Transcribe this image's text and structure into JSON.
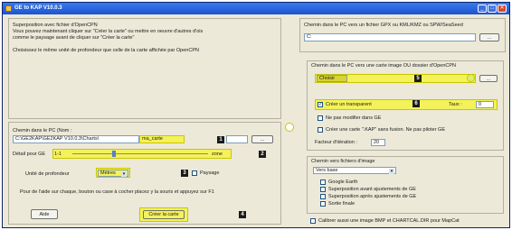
{
  "window": {
    "title": "GE to KAP V10.0.3",
    "minimize_label": "_",
    "maximize_label": "□",
    "close_label": "✕"
  },
  "left": {
    "info_lines": [
      "Superposition avec fichier d'OpenCPN",
      "Vous pouvez maintenant cliquer sur \"Créer la carte\" ou mettre en oeuvre d'autres d'ois",
      "comme le paysage avant de cliquer sur \"Créer la carte\"",
      "",
      "Choisissez le même unité de profondeur que celle de la carte affichée par OpenCPN"
    ],
    "path_label": "Chemin dans le PC (Nom :",
    "path_value": "C:\\GE2KAP\\GE2KAP V10.0.3\\Charts\\",
    "path_name_value": "ma_carte",
    "browse_label": "...",
    "slider_label": "Détail pour GE",
    "slider_value_left": "1-1",
    "slider_value_right": "zone",
    "depth_label": "Unité de profondeur",
    "depth_value": "Mètres",
    "paysage_label": "Paysage",
    "help_line": "Pour de l'aide sur chaque, bouton ou case à cocher placez y la souris et appuyez sur F1",
    "aide_label": "Aide",
    "create_label": "Créer la carte",
    "marks": [
      "1",
      "2",
      "3",
      "4"
    ]
  },
  "right": {
    "top_label": "Chemin dans le PC vers un fichier GPX ou KML/KMZ ou SPW/SeaSeed",
    "top_value": "C:",
    "top_browse": "...",
    "group1_title": "Chemin dans le PC vers une carte image OU dossier d'OpenCPN",
    "image_path_value": "Choisir",
    "mark5": "5",
    "mark6": "6",
    "transparent_label": "Créer un transparent",
    "taux_label": "Taux :",
    "taux_value": "0",
    "no_modify_label": "Ne pas modifier dans GE",
    "create_kap_label": "Créer une carte \".KAP\" sans fusion. Ne pas piloter GE",
    "iterations_label": "Facteur d'itération :",
    "iterations_value": "20",
    "group2_title": "Chemin vers fichiers d'image",
    "image_files_value": "Vers base",
    "options": [
      "Google Earth",
      "Superposition avant ajustements de GE",
      "Superposition après ajustements de GE",
      "Sortie finale"
    ],
    "bottom_check": "Calibrer aussi une image BMP et CHARTCAL.DIR pour MapCat"
  },
  "colors": {
    "titlebar": "#1c54d0",
    "highlight": "#f4f25a",
    "panel": "#ece9d8"
  }
}
